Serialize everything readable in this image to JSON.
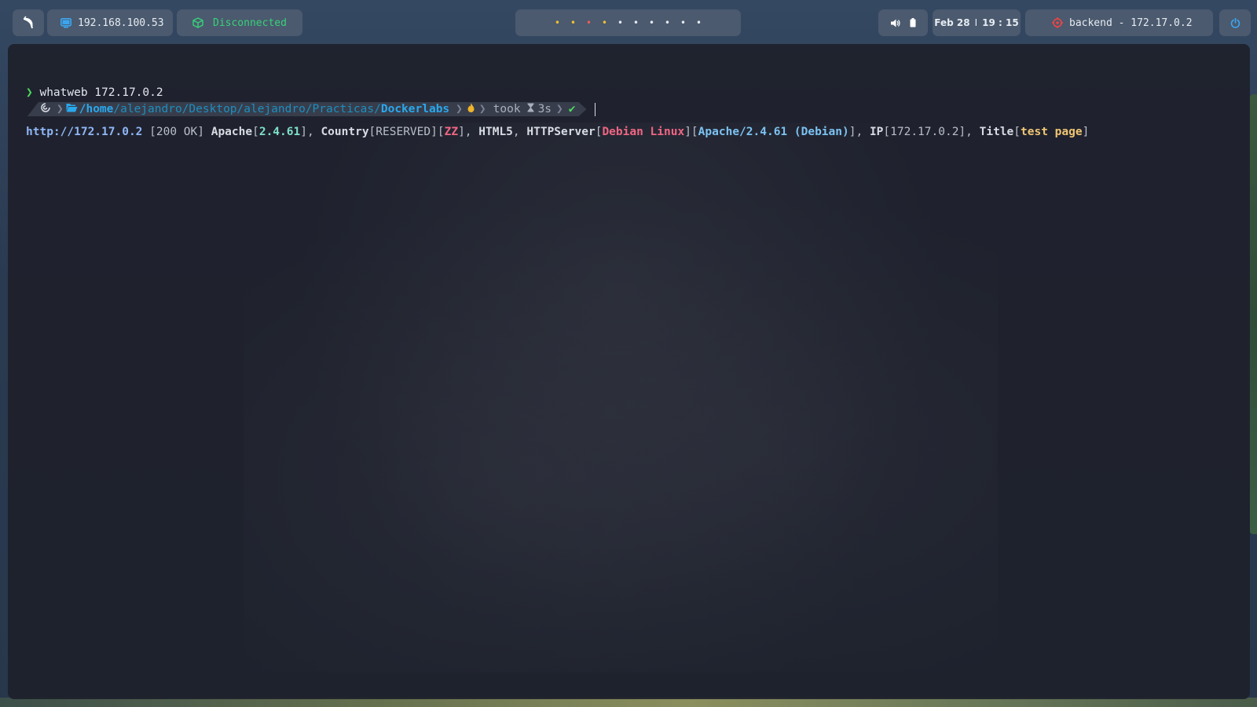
{
  "topbar": {
    "ip_address": "192.168.100.53",
    "vpn_status": "Disconnected",
    "workspaces": [
      {
        "glyph": "•",
        "color": "#f2c230"
      },
      {
        "glyph": "•",
        "color": "#f2c230"
      },
      {
        "glyph": "•",
        "color": "#ef5a5a"
      },
      {
        "glyph": "•",
        "color": "#f2c230"
      },
      {
        "glyph": "•",
        "color": "#e6ebf2"
      },
      {
        "glyph": "•",
        "color": "#e6ebf2"
      },
      {
        "glyph": "•",
        "color": "#e6ebf2"
      },
      {
        "glyph": "•",
        "color": "#e6ebf2"
      },
      {
        "glyph": "•",
        "color": "#e6ebf2"
      },
      {
        "glyph": "•",
        "color": "#e6ebf2"
      }
    ],
    "date": "Feb 28",
    "date_separator": "I",
    "time": "19 : 15",
    "target": "backend - 172.17.0.2"
  },
  "terminal": {
    "command_prefix": "❯",
    "command": "whatweb 172.17.0.2",
    "output": {
      "url": "http://172.17.0.2",
      "status": " [200 OK] ",
      "apache_label": "Apache",
      "apache_version": "2.4.61",
      "country_label": "Country",
      "country_value": "[RESERVED]",
      "country_code": "ZZ",
      "html5": "HTML5",
      "httpserver_label": "HTTPServer",
      "httpserver_os": "Debian Linux",
      "httpserver_value": "Apache/2.4.61 (Debian)",
      "ip_label": "IP",
      "ip_value": "[172.17.0.2]",
      "title_label": "Title",
      "title_value": "test page"
    },
    "prompt": {
      "path_root": "/",
      "path_home": "home",
      "path_mid": "/alejandro/Desktop/alejandro/Practicas/",
      "path_end": "Dockerlabs",
      "took_label": "took",
      "duration": "3s",
      "status_check": "✔"
    }
  }
}
